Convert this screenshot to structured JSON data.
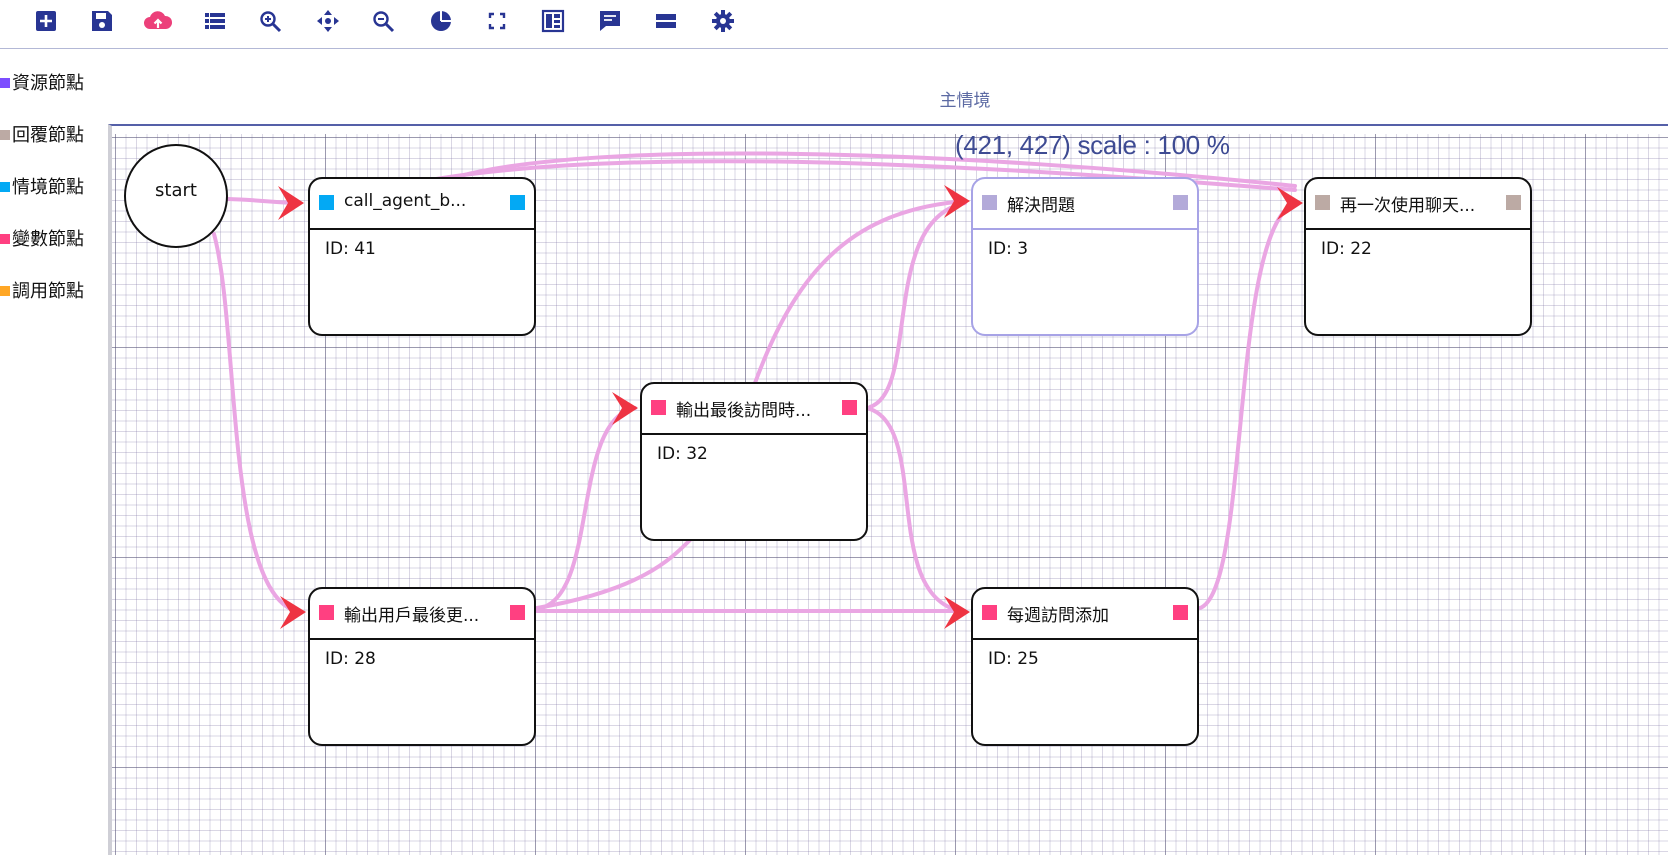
{
  "toolbar": {
    "buttons": [
      {
        "name": "add-icon",
        "label": "add"
      },
      {
        "name": "save-icon",
        "label": "save"
      },
      {
        "name": "cloud-upload-icon",
        "label": "upload"
      },
      {
        "name": "list-icon",
        "label": "list"
      },
      {
        "name": "zoom-in-icon",
        "label": "zoom in"
      },
      {
        "name": "move-icon",
        "label": "move"
      },
      {
        "name": "zoom-out-icon",
        "label": "zoom out"
      },
      {
        "name": "pie-chart-icon",
        "label": "chart"
      },
      {
        "name": "fullscreen-icon",
        "label": "fullscreen"
      },
      {
        "name": "dashboard-icon",
        "label": "dashboard"
      },
      {
        "name": "comment-icon",
        "label": "comment"
      },
      {
        "name": "menu-bars-icon",
        "label": "menu"
      },
      {
        "name": "gear-icon",
        "label": "settings"
      }
    ],
    "colors": {
      "primary": "#283593",
      "upload": "#ec407a"
    }
  },
  "legend": {
    "items": [
      {
        "label": "資源節點",
        "color": "#7c4dff"
      },
      {
        "label": "回覆節點",
        "color": "#bcaaa4"
      },
      {
        "label": "情境節點",
        "color": "#03a9f4"
      },
      {
        "label": "變數節點",
        "color": "#ff4081"
      },
      {
        "label": "調用節點",
        "color": "#ffa726"
      }
    ]
  },
  "scene": {
    "title": "主情境"
  },
  "canvas": {
    "coordinate_readout": "(421, 427) scale : 100 %"
  },
  "start_node": {
    "label": "start"
  },
  "nodes": [
    {
      "key": "call_agent",
      "title": "call_agent_b...",
      "id_text": "ID: 41",
      "color": "#03a9f4",
      "selected": false
    },
    {
      "key": "resolve",
      "title": "解決問題",
      "id_text": "ID: 3",
      "color": "#b3aad9",
      "selected": true
    },
    {
      "key": "reuse_chat",
      "title": "再一次使用聊天...",
      "id_text": "ID: 22",
      "color": "#bcaaa4",
      "selected": false
    },
    {
      "key": "last_visit",
      "title": "輸出最後訪問時...",
      "id_text": "ID: 32",
      "color": "#ff4081",
      "selected": false
    },
    {
      "key": "user_last",
      "title": "輸出用戶最後更...",
      "id_text": "ID: 28",
      "color": "#ff4081",
      "selected": false
    },
    {
      "key": "weekly",
      "title": "每週訪問添加",
      "id_text": "ID: 25",
      "color": "#ff4081",
      "selected": false
    }
  ],
  "edge_colors": {
    "line": "#eaa6e3",
    "arrow": "#ee3442"
  }
}
